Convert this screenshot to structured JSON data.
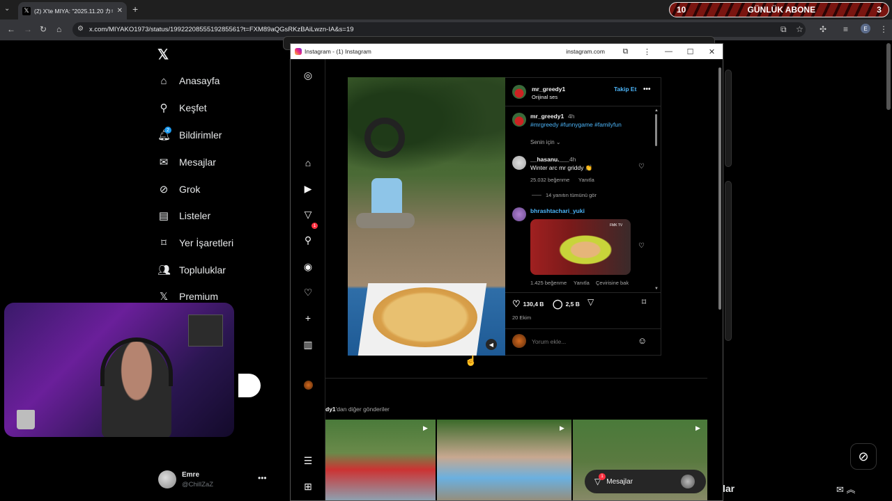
{
  "browser": {
    "tab_title": "(2) X'te MIYA: \"2025.11.20 カキフ",
    "tab_close": "✕",
    "new_tab": "+",
    "url": "x.com/MIYAKO1973/status/1992220855519285561?t=FXM89aQGsRKzBAiLwzn-IA&s=19",
    "profile_initial": "E"
  },
  "abone_banner": {
    "left": "10",
    "label": "GÜNLÜK ABONE",
    "right": "3"
  },
  "x_sidebar": {
    "items": [
      {
        "label": "Anasayfa",
        "icon": "home-icon"
      },
      {
        "label": "Keşfet",
        "icon": "search-icon"
      },
      {
        "label": "Bildirimler",
        "icon": "bell-icon"
      },
      {
        "label": "Mesajlar",
        "icon": "mail-icon"
      },
      {
        "label": "Grok",
        "icon": "grok-icon"
      },
      {
        "label": "Listeler",
        "icon": "list-icon"
      },
      {
        "label": "Yer İşaretleri",
        "icon": "bookmark-icon"
      },
      {
        "label": "Topluluklar",
        "icon": "communities-icon"
      },
      {
        "label": "Premium",
        "icon": "x-icon"
      }
    ],
    "notif_count": "2",
    "user": {
      "name": "Emre",
      "handle": "@ChillZaZ"
    }
  },
  "x_right": {
    "partial_text": "lar"
  },
  "instagram": {
    "window_title": "Instagram - (1) Instagram",
    "domain": "instagram.com",
    "notif_count": "1",
    "post": {
      "username": "mr_greedy1",
      "audio": "Orijinal ses",
      "follow_label": "Takip Et",
      "caption_time": "4h",
      "hashtags": "#mrgreedy #funnygame #familyfun",
      "sort_label": "Senin için",
      "comments": [
        {
          "user": "__hasanu.___",
          "time": "4h",
          "text": "Winter arc mr griddy 👏",
          "likes": "25.032 beğenme",
          "reply": "Yanıtla",
          "view_replies": "14 yanıtın tümünü gör"
        },
        {
          "user": "bhrashtachari_yuki",
          "gif_label": "FMK TV",
          "likes": "1.425 beğenme",
          "reply": "Yanıtla",
          "translate": "Çevirisine bak"
        }
      ],
      "like_count": "130,4 B",
      "comment_count": "2,5 B",
      "date": "20 Ekim",
      "add_comment_placeholder": "Yorum ekle..."
    },
    "more_posts_user": "dy1",
    "more_posts_suffix": "'dan diğer gönderiler",
    "dm_label": "Mesajlar",
    "dm_count": "1"
  }
}
